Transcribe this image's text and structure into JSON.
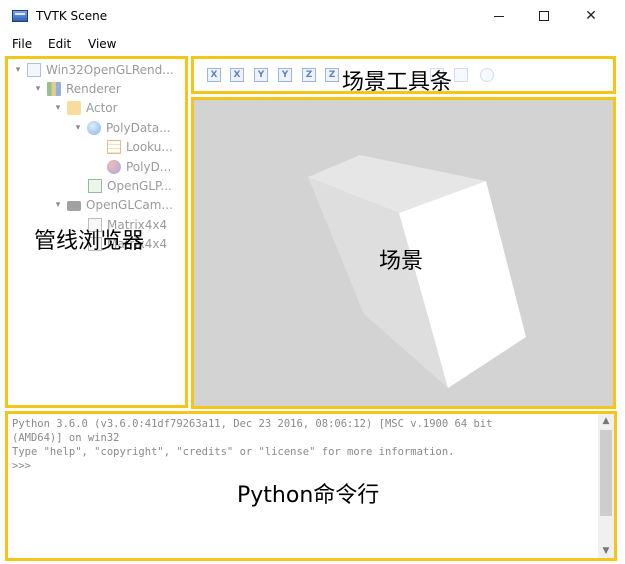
{
  "window": {
    "title": "TVTK Scene",
    "minimize_icon": "minimize-icon",
    "maximize_icon": "maximize-icon",
    "close_glyph": "✕"
  },
  "menu": {
    "items": [
      "File",
      "Edit",
      "View"
    ]
  },
  "tree": {
    "items": [
      {
        "label": "Win32OpenGLRend...",
        "icon": "window-icon",
        "expanded": true
      },
      {
        "label": "Renderer",
        "icon": "renderer-icon",
        "expanded": true
      },
      {
        "label": "Actor",
        "icon": "actor-icon",
        "expanded": true
      },
      {
        "label": "PolyData...",
        "icon": "polydata-icon",
        "expanded": true
      },
      {
        "label": "Looku...",
        "icon": "lookup-table-icon"
      },
      {
        "label": "PolyD...",
        "icon": "polydata-mapper-icon"
      },
      {
        "label": "OpenGLP...",
        "icon": "opengl-property-icon"
      },
      {
        "label": "OpenGLCam...",
        "icon": "camera-icon",
        "expanded": true
      },
      {
        "label": "Matrix4x4",
        "icon": "matrix-icon"
      },
      {
        "label": "Matrix4x4",
        "icon": "matrix-icon"
      }
    ]
  },
  "toolbar": {
    "buttons": [
      "X",
      "X",
      "Y",
      "Y",
      "Z",
      "Z"
    ]
  },
  "annotations": {
    "tree": "管线浏览器",
    "toolbar": "场景工具条",
    "scene": "场景",
    "shell": "Python命令行"
  },
  "shell": {
    "lines": [
      "Python 3.6.0 (v3.6.0:41df79263a11, Dec 23 2016, 08:06:12) [MSC v.1900 64 bit",
      "(AMD64)] on win32",
      "Type \"help\", \"copyright\", \"credits\" or \"license\" for more information.",
      ">>>"
    ]
  },
  "colors": {
    "highlight_border": "#f5c518",
    "scene_background": "#d3d3d3"
  }
}
